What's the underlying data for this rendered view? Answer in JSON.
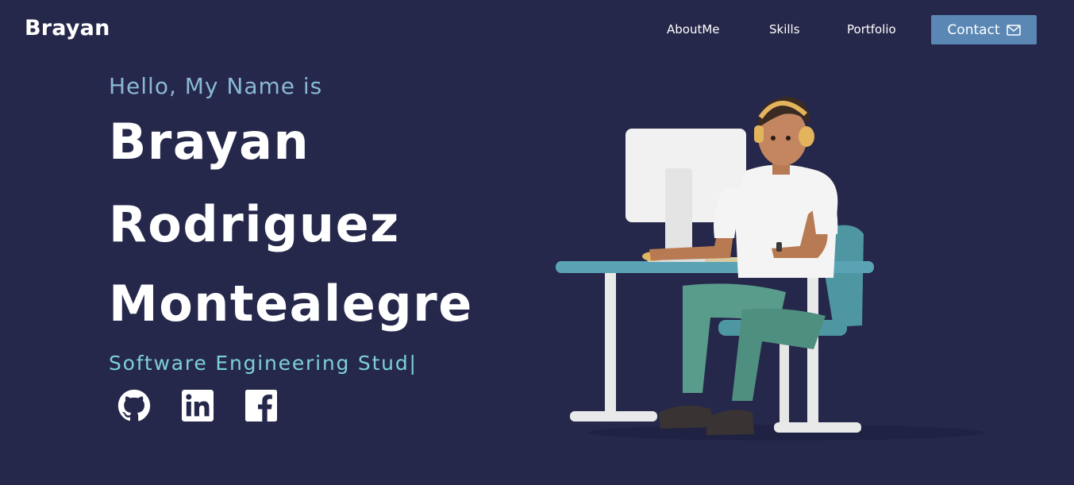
{
  "header": {
    "brand": "Brayan",
    "nav": {
      "about": "AboutMe",
      "skills": "Skills",
      "portfolio": "Portfolio",
      "contact": "Contact"
    }
  },
  "hero": {
    "greeting": "Hello, My Name is",
    "name_lines": [
      "Brayan",
      "Rodriguez",
      "Montealegre"
    ],
    "typed_role": "Software Engineering Stud|"
  },
  "social": {
    "github_icon": "github-icon",
    "linkedin_icon": "linkedin-icon",
    "facebook_icon": "facebook-icon"
  },
  "colors": {
    "background": "#26284b",
    "greeting": "#8ab9d6",
    "role": "#7ed0d6",
    "contact_button": "#5b87b5"
  }
}
